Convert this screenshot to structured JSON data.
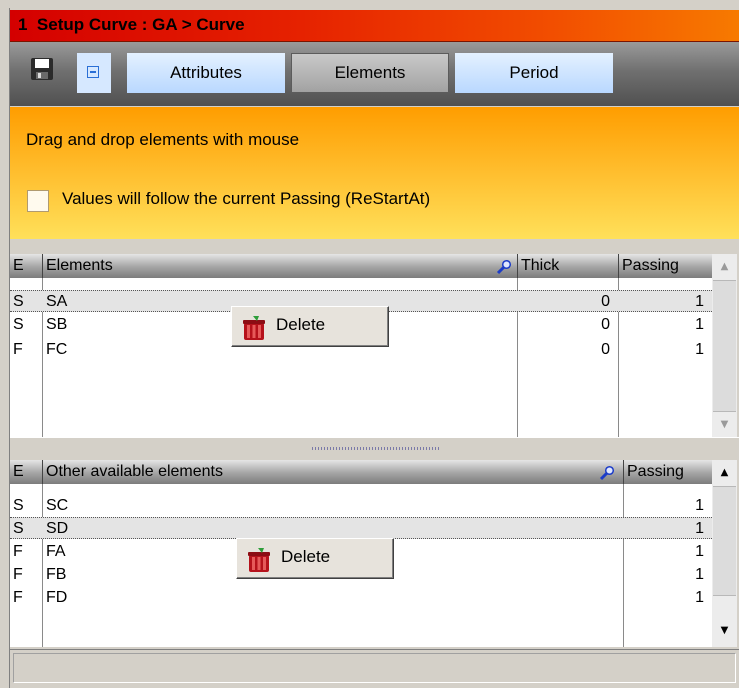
{
  "window": {
    "title": "1  Setup Curve : GA > Curve"
  },
  "toolbar": {
    "save_icon": "floppy-disk-icon",
    "collapse_icon": "minus-box-icon",
    "tabs": [
      {
        "label": "Attributes",
        "active": false
      },
      {
        "label": "Elements",
        "active": true
      },
      {
        "label": "Period",
        "active": false
      }
    ]
  },
  "banner": {
    "message": "Drag and drop elements with mouse",
    "checkbox_label": "Values will follow the current Passing (ReStartAt)",
    "checkbox_checked": false
  },
  "elements_grid": {
    "columns": [
      "E",
      "Elements",
      "Thick",
      "Passing"
    ],
    "rows": [
      {
        "e": "S",
        "name": "SA",
        "thick": "0",
        "passing": "1",
        "selected": true
      },
      {
        "e": "S",
        "name": "SB",
        "thick": "0",
        "passing": "1",
        "selected": false
      },
      {
        "e": "F",
        "name": "FC",
        "thick": "0",
        "passing": "1",
        "selected": false
      }
    ],
    "context_button": "Delete"
  },
  "available_grid": {
    "columns": [
      "E",
      "Other available elements",
      "Passing"
    ],
    "rows": [
      {
        "e": "S",
        "name": "SC",
        "passing": "1",
        "selected": false
      },
      {
        "e": "S",
        "name": "SD",
        "passing": "1",
        "selected": true
      },
      {
        "e": "F",
        "name": "FA",
        "passing": "1",
        "selected": false
      },
      {
        "e": "F",
        "name": "FB",
        "passing": "1",
        "selected": false
      },
      {
        "e": "F",
        "name": "FD",
        "passing": "1",
        "selected": false
      }
    ],
    "context_button": "Delete"
  },
  "status_bar": {
    "text": ""
  },
  "colors": {
    "title_red": "#d40000",
    "banner_orange": "#ff9d00",
    "banner_yellow": "#ffe05a"
  }
}
